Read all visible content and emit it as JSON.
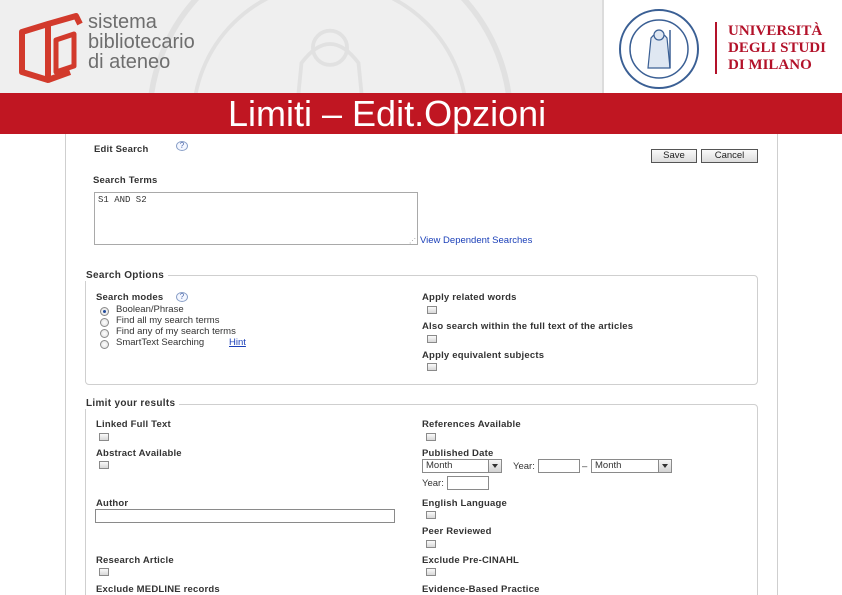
{
  "header": {
    "library_lines": [
      "sistema",
      "bibliotecario",
      "di ateneo"
    ],
    "university_lines": [
      "UNIVERSITÀ",
      "DEGLI STUDI",
      "DI MILANO"
    ],
    "seal_text": "UNIVERSITAS STUDIORUM MEDIOLANENSIS",
    "banner_title": "Limiti – Edit.Opzioni",
    "brand_red": "#c01622"
  },
  "edit_search": {
    "title": "Edit Search",
    "help": "?",
    "save_label": "Save",
    "cancel_label": "Cancel",
    "search_terms_label": "Search Terms",
    "search_terms_value": "S1 AND S2",
    "view_dependent": "View Dependent Searches"
  },
  "search_options": {
    "legend": "Search Options",
    "modes_label": "Search modes",
    "modes": [
      {
        "label": "Boolean/Phrase",
        "selected": true
      },
      {
        "label": "Find all my search terms",
        "selected": false
      },
      {
        "label": "Find any of my search terms",
        "selected": false
      },
      {
        "label": "SmartText Searching",
        "selected": false
      }
    ],
    "hint_link": "Hint",
    "apply_related": "Apply related words",
    "full_text": "Also search within the full text of the articles",
    "equivalent": "Apply equivalent subjects"
  },
  "limits": {
    "legend": "Limit your results",
    "linked_full_text": "Linked Full Text",
    "abstract_available": "Abstract Available",
    "author": "Author",
    "research_article": "Research Article",
    "exclude_medline": "Exclude MEDLINE records",
    "references_available": "References Available",
    "published_date": "Published Date",
    "month_placeholder": "Month",
    "year_label": "Year:",
    "dash": "–",
    "english": "English Language",
    "peer_reviewed": "Peer Reviewed",
    "exclude_pre_cinahl": "Exclude Pre-CINAHL",
    "evidence_based": "Evidence-Based Practice"
  }
}
